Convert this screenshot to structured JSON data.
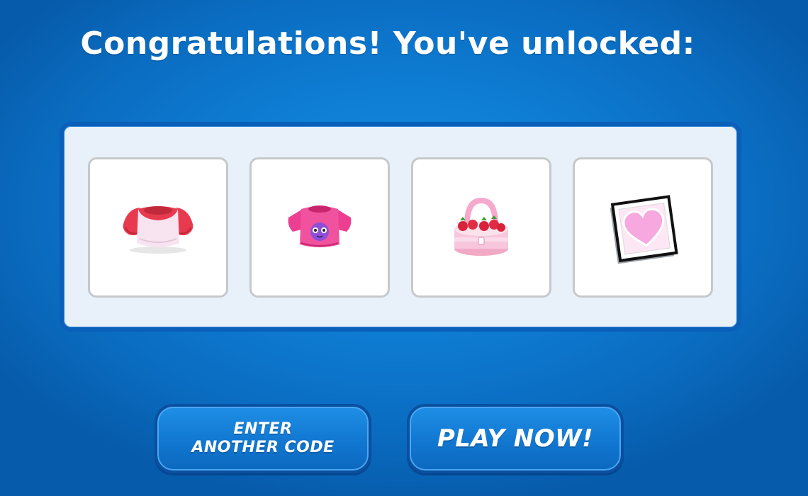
{
  "title": "Congratulations! You've unlocked:",
  "items": [
    {
      "name": "Pink raglan shirt",
      "icon": "pink-raglan-shirt-icon"
    },
    {
      "name": "Pink puffle t-shirt",
      "icon": "pink-puffle-tshirt-icon"
    },
    {
      "name": "Strawberry cake purse",
      "icon": "strawberry-cake-purse-icon"
    },
    {
      "name": "Heart picture frame",
      "icon": "heart-picture-icon"
    }
  ],
  "buttons": {
    "enter_another_code": "ENTER\nANOTHER CODE",
    "play_now": "PLAY NOW!"
  },
  "colors": {
    "background": "#0e7dd4",
    "panel": "#e8f1f9",
    "panel_border": "#0a5fb8",
    "button": "#1177d1"
  }
}
